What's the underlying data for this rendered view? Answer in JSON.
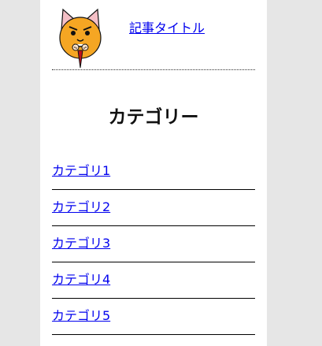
{
  "article": {
    "title": "記事タイトル",
    "thumbnail_icon": "cat-face-icon"
  },
  "sidebar": {
    "heading": "カテゴリー",
    "categories": [
      {
        "label": "カテゴリ1"
      },
      {
        "label": "カテゴリ2"
      },
      {
        "label": "カテゴリ3"
      },
      {
        "label": "カテゴリ4"
      },
      {
        "label": "カテゴリ5"
      }
    ]
  },
  "colors": {
    "background": "#e6e6e6",
    "panel": "#ffffff",
    "link": "#0000ee"
  }
}
